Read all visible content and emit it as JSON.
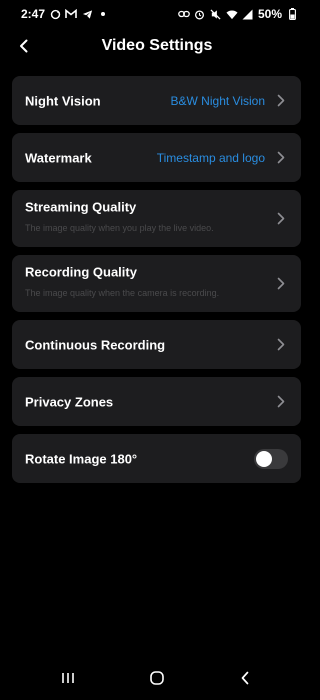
{
  "status_bar": {
    "time": "2:47",
    "battery": "50%",
    "left_icons": [
      "sync-icon",
      "gmail-icon",
      "telegram-icon",
      "notification-dot-icon"
    ],
    "right_icons": [
      "link-icon",
      "alarm-icon",
      "mute-icon",
      "wifi-icon",
      "signal-icon",
      "battery-icon"
    ]
  },
  "header": {
    "title": "Video Settings",
    "back_icon": "back-chevron-icon"
  },
  "colors": {
    "background": "#000000",
    "card": "#1d1d1f",
    "accent": "#2a8de0",
    "subtitle": "#4a4a4c",
    "toggle_off": "#3a3a3c"
  },
  "settings": {
    "night_vision": {
      "title": "Night Vision",
      "value": "B&W Night Vision"
    },
    "watermark": {
      "title": "Watermark",
      "value": "Timestamp and logo"
    },
    "streaming_quality": {
      "title": "Streaming Quality",
      "subtitle": "The image quality when you play the live video."
    },
    "recording_quality": {
      "title": "Recording Quality",
      "subtitle": "The image quality when the camera is recording."
    },
    "continuous_recording": {
      "title": "Continuous Recording"
    },
    "privacy_zones": {
      "title": "Privacy Zones"
    },
    "rotate_image": {
      "title": "Rotate Image 180°",
      "enabled": false
    }
  },
  "nav_bar": {
    "icons": [
      "recents-icon",
      "home-icon",
      "back-icon"
    ]
  }
}
